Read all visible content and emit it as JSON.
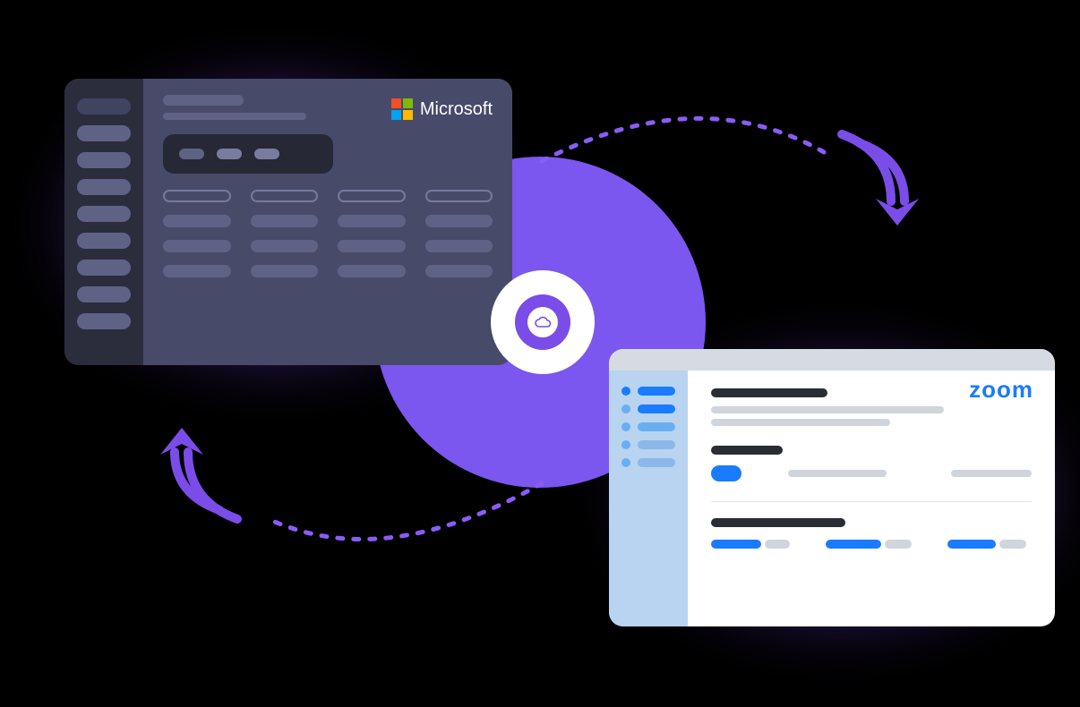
{
  "diagram": {
    "description": "Integration sync diagram between Microsoft and Zoom via a cloud connector",
    "connector_icon": "cloud"
  },
  "microsoft_card": {
    "brand_label": "Microsoft",
    "logo_colors": [
      "#f25022",
      "#7fba00",
      "#00a4ef",
      "#ffb900"
    ]
  },
  "zoom_card": {
    "brand_label": "zoom",
    "brand_color": "#1a7bff"
  },
  "colors": {
    "accent_purple": "#7b57f0",
    "ms_card_bg": "#484a6a",
    "ms_sidebar_bg": "#2b2d3d",
    "zoom_sidebar_bg": "#b8d4f0"
  }
}
